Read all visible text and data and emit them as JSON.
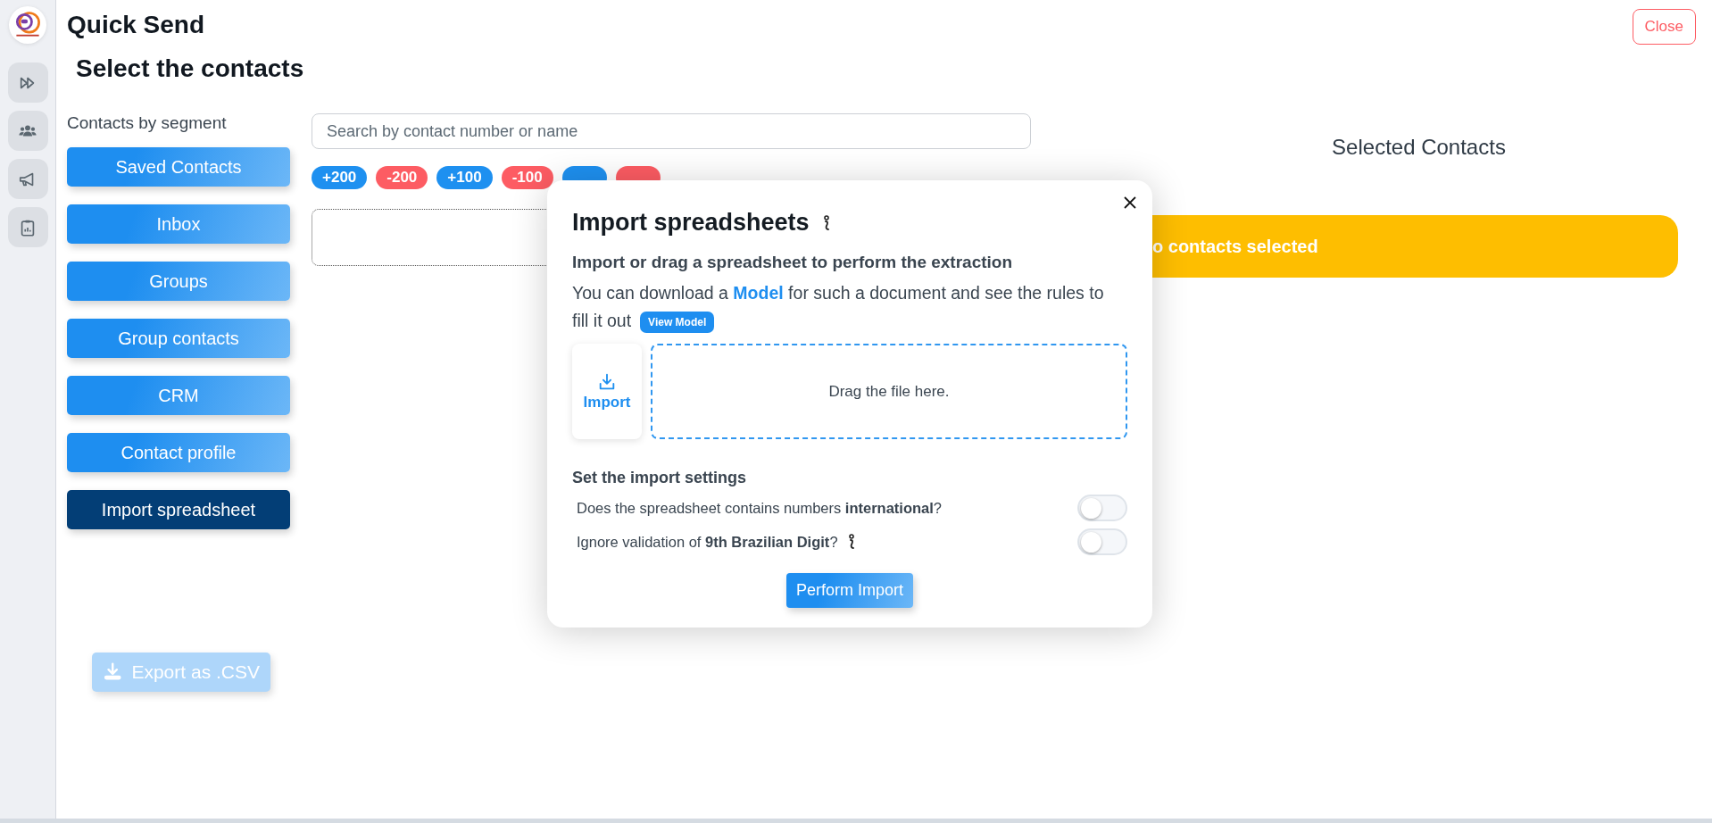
{
  "page": {
    "title": "Quick Send",
    "subtitle": "Select the contacts",
    "close": "Close"
  },
  "rail": [
    {
      "kind": "forward"
    },
    {
      "kind": "users"
    },
    {
      "kind": "megaphone"
    },
    {
      "kind": "clipboard"
    }
  ],
  "segments": {
    "label": "Contacts by segment",
    "items": [
      {
        "label": "Saved Contacts",
        "selected": false
      },
      {
        "label": "Inbox",
        "selected": false
      },
      {
        "label": "Groups",
        "selected": false
      },
      {
        "label": "Group contacts",
        "selected": false
      },
      {
        "label": "CRM",
        "selected": false
      },
      {
        "label": "Contact profile",
        "selected": false
      },
      {
        "label": "Import spreadsheet",
        "selected": true
      }
    ]
  },
  "export": {
    "label": "Export as .CSV",
    "disabled": true
  },
  "search": {
    "placeholder": "Search by contact number or name"
  },
  "chips": [
    {
      "label": "+200",
      "color": "#1e90f0"
    },
    {
      "label": "-200",
      "color": "#fd5c63"
    },
    {
      "label": "+100",
      "color": "#1e90f0"
    },
    {
      "label": "-100",
      "color": "#fd5c63"
    },
    {
      "color": "#1e90f0"
    },
    {
      "color": "#fd5c63"
    }
  ],
  "selected": {
    "title": "Selected Contacts",
    "empty": "o contacts selected"
  },
  "modal": {
    "title": "Import spreadsheets",
    "heading": "Import or drag a spreadsheet to perform the extraction",
    "text": "You can download a **Model** for such a document and see the rules to",
    "text_2": "fill it out",
    "view_model": "View Model",
    "import": "Import",
    "drop": "Drag the file here.",
    "settings_title": "Set the import settings",
    "settings": [
      {
        "text": "Does the spreadsheet contains numbers **international**?",
        "info": false,
        "on": false
      },
      {
        "text": "Ignore validation of **9th Brazilian Digit**?",
        "info": true,
        "on": false
      }
    ],
    "submit": "Perform Import"
  }
}
